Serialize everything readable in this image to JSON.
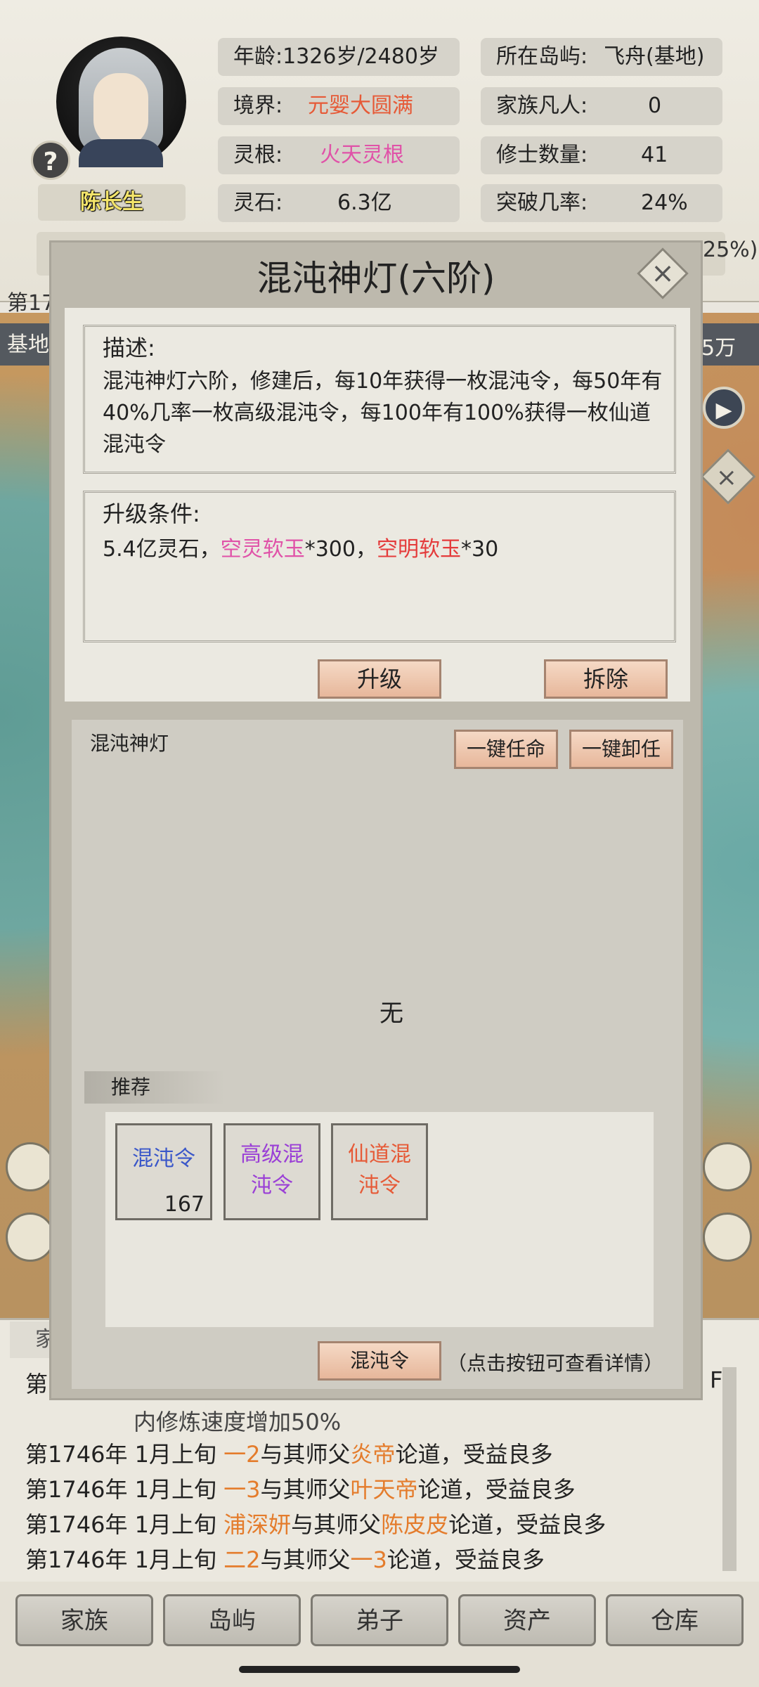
{
  "player": {
    "name": "陈长生",
    "help_symbol": "?"
  },
  "stats_left": [
    {
      "label": "年龄:1326岁/2480岁",
      "value": ""
    },
    {
      "label": "境界:",
      "value": "元婴大圆满",
      "color": "#e65a37"
    },
    {
      "label": "灵根:",
      "value": "火天灵根",
      "color": "#e052a8"
    },
    {
      "label": "灵石:",
      "value": "6.3亿",
      "color": "#222222"
    }
  ],
  "stats_right": [
    {
      "label": "所在岛屿:",
      "value": "飞舟(基地)"
    },
    {
      "label": "家族凡人:",
      "value": "0"
    },
    {
      "label": "修士数量:",
      "value": "41"
    },
    {
      "label": "突破几率:",
      "value": "24%"
    }
  ],
  "partial": {
    "pct": "25%)",
    "year": "第17",
    "map_left": "基地",
    "map_right": "5万"
  },
  "modal": {
    "title": "混沌神灯(六阶)",
    "close_symbol": "×",
    "description_title": "描述:",
    "description_text": "混沌神灯六阶，修建后，每10年获得一枚混沌令，每50年有40%几率一枚高级混沌令，每100年有100%获得一枚仙道混沌令",
    "condition_title": "升级条件:",
    "condition": {
      "part1": "5.4亿灵石，",
      "item1": "空灵软玉",
      "qty1": "*300，",
      "item2": "空明软玉",
      "qty2": "*30"
    },
    "upgrade_label": "升级",
    "demolish_label": "拆除",
    "assign_title": "混沌神灯",
    "appoint_all_label": "一键任命",
    "dismiss_all_label": "一键卸任",
    "empty_text": "无",
    "recommend_label": "推荐",
    "items": [
      {
        "name": "混沌令",
        "count": "167",
        "color": "#3a57c9"
      },
      {
        "name": "高级混沌令",
        "count": "",
        "color": "#9a3fd6"
      },
      {
        "name": "仙道混沌令",
        "count": "",
        "color": "#e65a37"
      }
    ],
    "token_button_label": "混沌令",
    "hint": "（点击按钮可查看详情）"
  },
  "log": {
    "tab_label": "家",
    "under_text": "内修炼速度增加50%",
    "lines": [
      {
        "prefix": "第1746年 1月上旬 ",
        "a": "一2",
        "mid": "与其师父",
        "b": "炎帝",
        "suffix": "论道，受益良多"
      },
      {
        "prefix": "第1746年 1月上旬 ",
        "a": "一3",
        "mid": "与其师父",
        "b": "叶天帝",
        "suffix": "论道，受益良多"
      },
      {
        "prefix": "第1746年 1月上旬 ",
        "a": "浦深妍",
        "mid": "与其师父",
        "b": "陈皮皮",
        "suffix": "论道，受益良多"
      },
      {
        "prefix": "第1746年 1月上旬 ",
        "a": "二2",
        "mid": "与其师父",
        "b": "一3",
        "suffix": "论道，受益良多"
      }
    ],
    "partial_first": "第",
    "partial_right": "F"
  },
  "nav": [
    "家族",
    "岛屿",
    "弟子",
    "资产",
    "仓库"
  ]
}
